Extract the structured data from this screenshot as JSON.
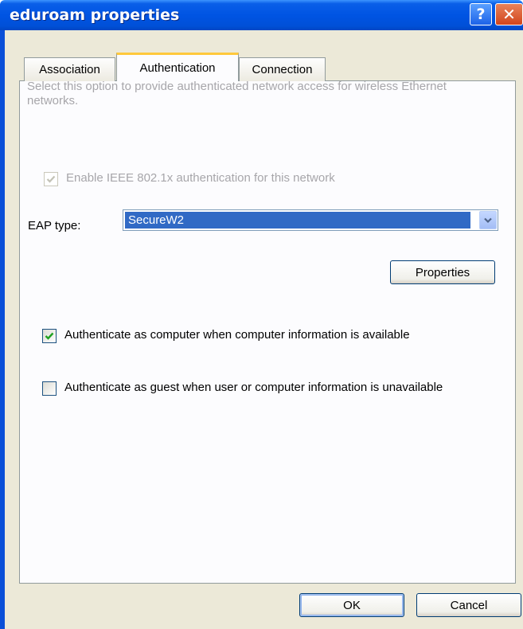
{
  "window": {
    "title": "eduroam properties",
    "help_label": "?",
    "close_label": "✕"
  },
  "tabs": [
    {
      "label": "Association",
      "selected": false
    },
    {
      "label": "Authentication",
      "selected": true
    },
    {
      "label": "Connection",
      "selected": false
    }
  ],
  "auth": {
    "description": "Select this option to provide authenticated network access for wireless Ethernet networks.",
    "enable_8021x": {
      "label": "Enable IEEE 802.1x authentication for this network",
      "checked": true,
      "disabled": true
    },
    "eap_type_label": "EAP type:",
    "eap_type_value": "SecureW2",
    "properties_label": "Properties",
    "auth_as_computer": {
      "label": "Authenticate as computer when computer information is available",
      "checked": true
    },
    "auth_as_guest": {
      "label": "Authenticate as guest when user or computer information is unavailable",
      "checked": false
    }
  },
  "footer": {
    "ok_label": "OK",
    "cancel_label": "Cancel"
  },
  "colors": {
    "titlebar": "#0054e3",
    "selection": "#316ac5",
    "tab_highlight": "#ffc83c",
    "close_button": "#d2451c",
    "dialog_bg": "#ece9d8"
  },
  "icons": [
    "help-icon",
    "close-icon",
    "chevron-down-icon",
    "checkmark-icon"
  ]
}
